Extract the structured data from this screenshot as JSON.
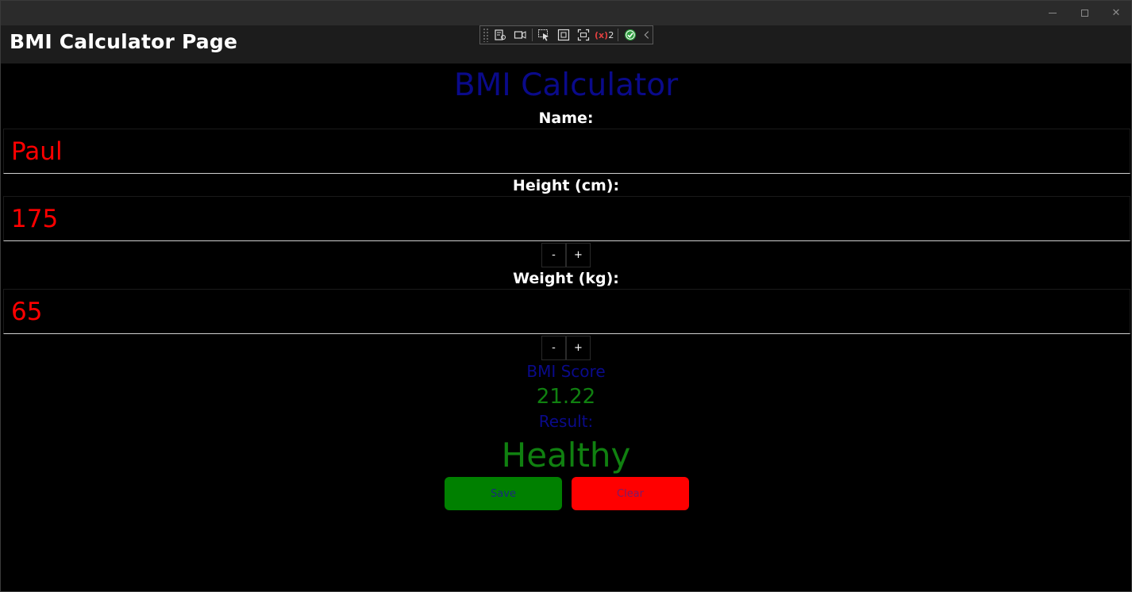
{
  "window": {
    "controls": {
      "minimize": "",
      "maximize": "",
      "close": "✕"
    }
  },
  "appbar": {
    "title": "BMI Calculator Page"
  },
  "debug_toolbar": {
    "icons": [
      "live-visual-tree-icon",
      "record-icon",
      "select-element-icon",
      "display-layout-adorners-icon",
      "track-focus-icon",
      "binding-failures-icon",
      "hot-reload-status-icon",
      "collapse-chevron-icon"
    ],
    "binding_failures_count": "2"
  },
  "main": {
    "heading": "BMI Calculator",
    "name": {
      "label": "Name:",
      "value": "Paul"
    },
    "height": {
      "label": "Height (cm):",
      "value": "175",
      "decrement": "-",
      "increment": "+"
    },
    "weight": {
      "label": "Weight (kg):",
      "value": "65",
      "decrement": "-",
      "increment": "+"
    },
    "bmi": {
      "label": "BMI Score",
      "value": "21.22"
    },
    "result": {
      "label": "Result:",
      "value": "Healthy"
    },
    "buttons": {
      "save": "Save",
      "clear": "Clear"
    }
  },
  "colors": {
    "heading": "#0a0a8a",
    "entry_text": "#ff0000",
    "score_text": "#108010",
    "save_bg": "#008000",
    "clear_bg": "#ff0000"
  }
}
